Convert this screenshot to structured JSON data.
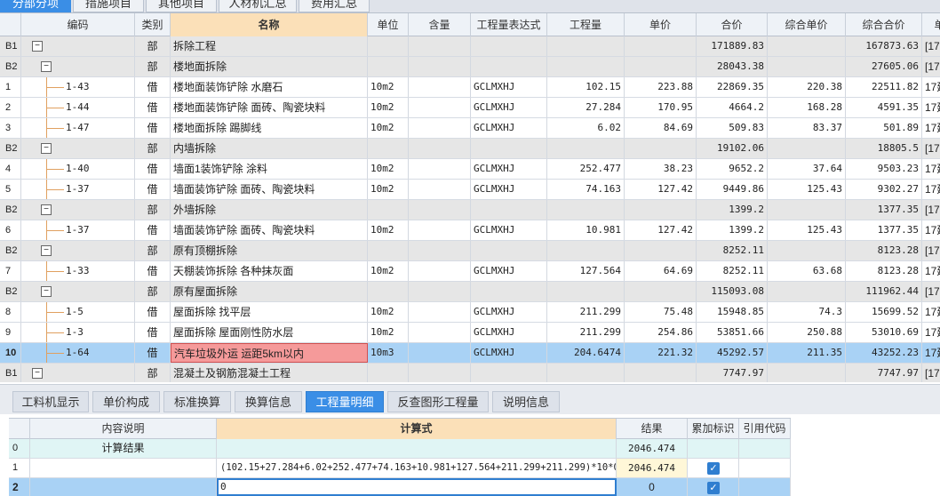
{
  "top_tabs": [
    "分部分项",
    "措施项目",
    "其他项目",
    "人材机汇总",
    "费用汇总"
  ],
  "columns": [
    "编码",
    "类别",
    "名称",
    "单位",
    "含量",
    "工程量表达式",
    "工程量",
    "单价",
    "合价",
    "综合单价",
    "综合合价",
    "单"
  ],
  "rows": [
    {
      "no": "B1",
      "kind": "部",
      "name": "拆除工程",
      "unit": "",
      "expr": "",
      "qty": "",
      "price": "",
      "total": "171889.83",
      "cprice": "",
      "ctotal": "167873.63",
      "extra": "[17"
    },
    {
      "no": "B2",
      "kind": "部",
      "name": "楼地面拆除",
      "unit": "",
      "expr": "",
      "qty": "",
      "price": "",
      "total": "28043.38",
      "cprice": "",
      "ctotal": "27605.06",
      "extra": "[17"
    },
    {
      "no": "1",
      "code": "1-43",
      "kind": "借",
      "name": "楼地面装饰铲除 水磨石",
      "unit": "10m2",
      "expr": "GCLMXHJ",
      "qty": "102.15",
      "price": "223.88",
      "total": "22869.35",
      "cprice": "220.38",
      "ctotal": "22511.82",
      "extra": "17建"
    },
    {
      "no": "2",
      "code": "1-44",
      "kind": "借",
      "name": "楼地面装饰铲除 面砖、陶瓷块料",
      "unit": "10m2",
      "expr": "GCLMXHJ",
      "qty": "27.284",
      "price": "170.95",
      "total": "4664.2",
      "cprice": "168.28",
      "ctotal": "4591.35",
      "extra": "17建"
    },
    {
      "no": "3",
      "code": "1-47",
      "kind": "借",
      "name": "楼地面拆除 踢脚线",
      "unit": "10m2",
      "expr": "GCLMXHJ",
      "qty": "6.02",
      "price": "84.69",
      "total": "509.83",
      "cprice": "83.37",
      "ctotal": "501.89",
      "extra": "17建"
    },
    {
      "no": "B2",
      "kind": "部",
      "name": "内墙拆除",
      "unit": "",
      "expr": "",
      "qty": "",
      "price": "",
      "total": "19102.06",
      "cprice": "",
      "ctotal": "18805.5",
      "extra": "[17"
    },
    {
      "no": "4",
      "code": "1-40",
      "kind": "借",
      "name": "墙面1装饰铲除 涂料",
      "unit": "10m2",
      "expr": "GCLMXHJ",
      "qty": "252.477",
      "price": "38.23",
      "total": "9652.2",
      "cprice": "37.64",
      "ctotal": "9503.23",
      "extra": "17建"
    },
    {
      "no": "5",
      "code": "1-37",
      "kind": "借",
      "name": "墙面装饰铲除 面砖、陶瓷块料",
      "unit": "10m2",
      "expr": "GCLMXHJ",
      "qty": "74.163",
      "price": "127.42",
      "total": "9449.86",
      "cprice": "125.43",
      "ctotal": "9302.27",
      "extra": "17建"
    },
    {
      "no": "B2",
      "kind": "部",
      "name": "外墙拆除",
      "unit": "",
      "expr": "",
      "qty": "",
      "price": "",
      "total": "1399.2",
      "cprice": "",
      "ctotal": "1377.35",
      "extra": "[17"
    },
    {
      "no": "6",
      "code": "1-37",
      "kind": "借",
      "name": "墙面装饰铲除 面砖、陶瓷块料",
      "unit": "10m2",
      "expr": "GCLMXHJ",
      "qty": "10.981",
      "price": "127.42",
      "total": "1399.2",
      "cprice": "125.43",
      "ctotal": "1377.35",
      "extra": "17建"
    },
    {
      "no": "B2",
      "kind": "部",
      "name": "原有顶棚拆除",
      "unit": "",
      "expr": "",
      "qty": "",
      "price": "",
      "total": "8252.11",
      "cprice": "",
      "ctotal": "8123.28",
      "extra": "[17"
    },
    {
      "no": "7",
      "code": "1-33",
      "kind": "借",
      "name": "天棚装饰拆除 各种抹灰面",
      "unit": "10m2",
      "expr": "GCLMXHJ",
      "qty": "127.564",
      "price": "64.69",
      "total": "8252.11",
      "cprice": "63.68",
      "ctotal": "8123.28",
      "extra": "17建"
    },
    {
      "no": "B2",
      "kind": "部",
      "name": "原有屋面拆除",
      "unit": "",
      "expr": "",
      "qty": "",
      "price": "",
      "total": "115093.08",
      "cprice": "",
      "ctotal": "111962.44",
      "extra": "[17"
    },
    {
      "no": "8",
      "code": "1-5",
      "kind": "借",
      "name": "屋面拆除 找平层",
      "unit": "10m2",
      "expr": "GCLMXHJ",
      "qty": "211.299",
      "price": "75.48",
      "total": "15948.85",
      "cprice": "74.3",
      "ctotal": "15699.52",
      "extra": "17建"
    },
    {
      "no": "9",
      "code": "1-3",
      "kind": "借",
      "name": "屋面拆除 屋面刚性防水层",
      "unit": "10m2",
      "expr": "GCLMXHJ",
      "qty": "211.299",
      "price": "254.86",
      "total": "53851.66",
      "cprice": "250.88",
      "ctotal": "53010.69",
      "extra": "17建"
    },
    {
      "no": "10",
      "code": "1-64",
      "kind": "借",
      "name": "汽车垃圾外运 运距5km以内",
      "unit": "10m3",
      "expr": "GCLMXHJ",
      "qty": "204.6474",
      "price": "221.32",
      "total": "45292.57",
      "cprice": "211.35",
      "ctotal": "43252.23",
      "extra": "17建"
    },
    {
      "no": "B1",
      "kind": "部",
      "name": "混凝土及钢筋混凝土工程",
      "unit": "",
      "expr": "",
      "qty": "",
      "price": "",
      "total": "7747.97",
      "cprice": "",
      "ctotal": "7747.97",
      "extra": "[17"
    }
  ],
  "bottom_tabs": [
    "工料机显示",
    "单价构成",
    "标准换算",
    "换算信息",
    "工程量明细",
    "反查图形工程量",
    "说明信息"
  ],
  "detail_columns": [
    "内容说明",
    "计算式",
    "结果",
    "累加标识",
    "引用代码"
  ],
  "detail_rows": [
    {
      "no": "0",
      "desc": "计算结果",
      "formula": "",
      "result": "2046.474"
    },
    {
      "no": "1",
      "desc": "",
      "formula": "(102.15+27.284+6.02+252.477+74.163+10.981+127.564+211.299+211.299)*10*0.2",
      "result": "2046.474"
    },
    {
      "no": "2",
      "desc": "",
      "formula": "0",
      "result": "0"
    }
  ]
}
